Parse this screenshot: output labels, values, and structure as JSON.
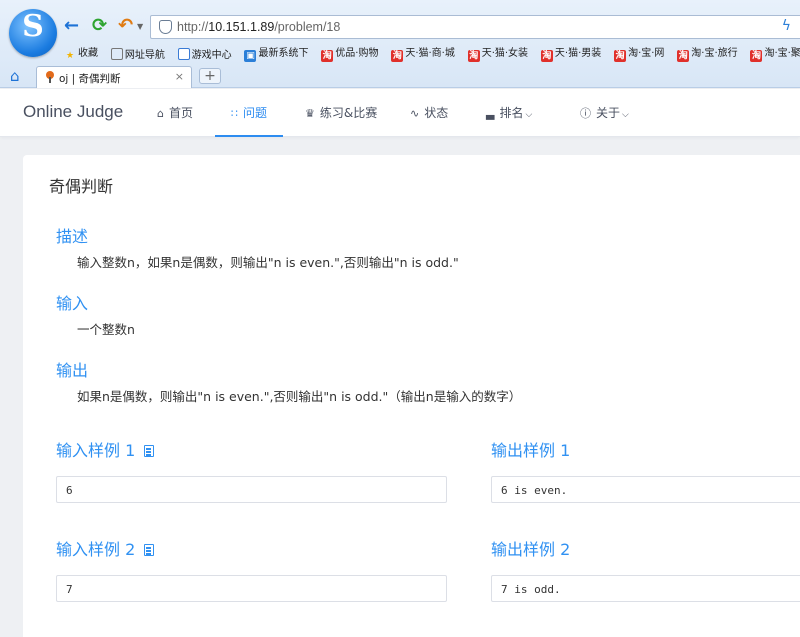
{
  "browser": {
    "url_prefix": "http://",
    "url_host": "10.151.1.89",
    "url_path": "/problem/18",
    "bookmarks": [
      {
        "label": "收藏",
        "icon": "star-icon"
      },
      {
        "label": "网址导航",
        "icon": "globe-icon"
      },
      {
        "label": "游戏中心",
        "icon": "document-icon"
      },
      {
        "label": "最新系统下",
        "icon": "system-icon"
      },
      {
        "label": "优品·购物",
        "icon": "taobao-icon"
      },
      {
        "label": "天·猫·商·城",
        "icon": "taobao-icon"
      },
      {
        "label": "天·猫·女装",
        "icon": "taobao-icon"
      },
      {
        "label": "天·猫·男装",
        "icon": "taobao-icon"
      },
      {
        "label": "淘·宝·网",
        "icon": "taobao-icon"
      },
      {
        "label": "淘·宝·旅行",
        "icon": "taobao-icon"
      },
      {
        "label": "淘·宝·聚·划",
        "icon": "taobao-icon"
      }
    ],
    "tab": {
      "title": "oj | 奇偶判断",
      "close": "×"
    },
    "new_tab": "+"
  },
  "site": {
    "brand": "Online Judge",
    "nav": [
      {
        "label": "首页",
        "icon": "home-icon"
      },
      {
        "label": "问题",
        "icon": "grid-icon",
        "active": true
      },
      {
        "label": "练习&比赛",
        "icon": "trophy-icon"
      },
      {
        "label": "状态",
        "icon": "pulse-icon"
      },
      {
        "label": "排名",
        "icon": "bar-chart-icon",
        "dropdown": true
      },
      {
        "label": "关于",
        "icon": "info-icon",
        "dropdown": true
      }
    ]
  },
  "problem": {
    "title": "奇偶判断",
    "description_heading": "描述",
    "description": "输入整数n，如果n是偶数，则输出\"n is even.\",否则输出\"n is odd.\"",
    "input_heading": "输入",
    "input": "一个整数n",
    "output_heading": "输出",
    "output": "如果n是偶数，则输出\"n is even.\",否则输出\"n is odd.\"（输出n是输入的数字）",
    "samples": [
      {
        "input_label": "输入样例 1",
        "output_label": "输出样例 1",
        "input": "6",
        "output": "6 is even."
      },
      {
        "input_label": "输入样例 2",
        "output_label": "输出样例 2",
        "input": "7",
        "output": "7 is odd."
      }
    ]
  },
  "colors": {
    "accent": "#2d8cf0",
    "heading": "#3091f2",
    "brand_text": "#495060"
  }
}
